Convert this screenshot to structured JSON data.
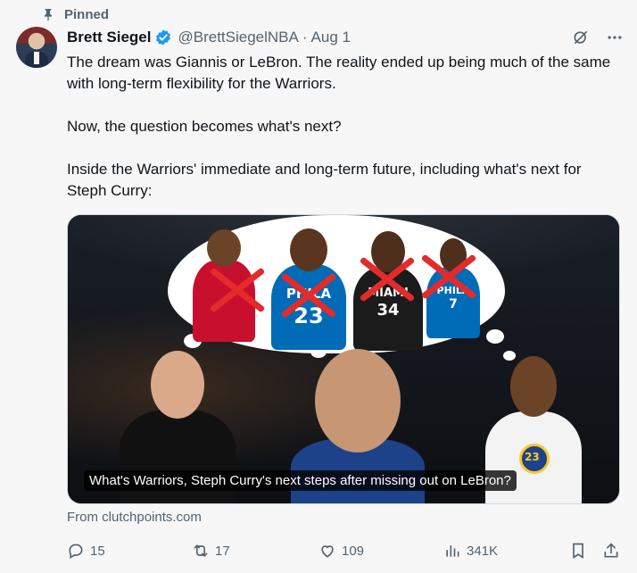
{
  "pinned_label": "Pinned",
  "author": {
    "name": "Brett Siegel",
    "handle": "@BrettSiegelNBA",
    "separator": "·",
    "date": "Aug 1",
    "verified": true
  },
  "tweet": {
    "paragraphs": [
      "The dream was Giannis or LeBron. The reality ended up being much of the same with long-term flexibility for the Warriors.",
      "Now, the question becomes what's next?",
      "Inside the Warriors' immediate and long-term future, including what's next for Steph Curry:"
    ]
  },
  "card": {
    "caption": "What's Warriors, Steph Curry's next steps after missing out on LeBron?",
    "source": "From clutchpoints.com",
    "jerseys": {
      "jersey_1": "PHILA",
      "jersey_1_number": "23",
      "jersey_2": "MIAMI",
      "jersey_2_number": "34",
      "jersey_3": "PHILA",
      "jersey_3_number": "7",
      "jersey_4_number": "23"
    }
  },
  "metrics": {
    "replies": "15",
    "reposts": "17",
    "likes": "109",
    "views": "341K"
  },
  "colors": {
    "accent_verified": "#1d9bf0",
    "muted": "#536471",
    "text": "#0f1419",
    "background": "#f7f7f7"
  }
}
